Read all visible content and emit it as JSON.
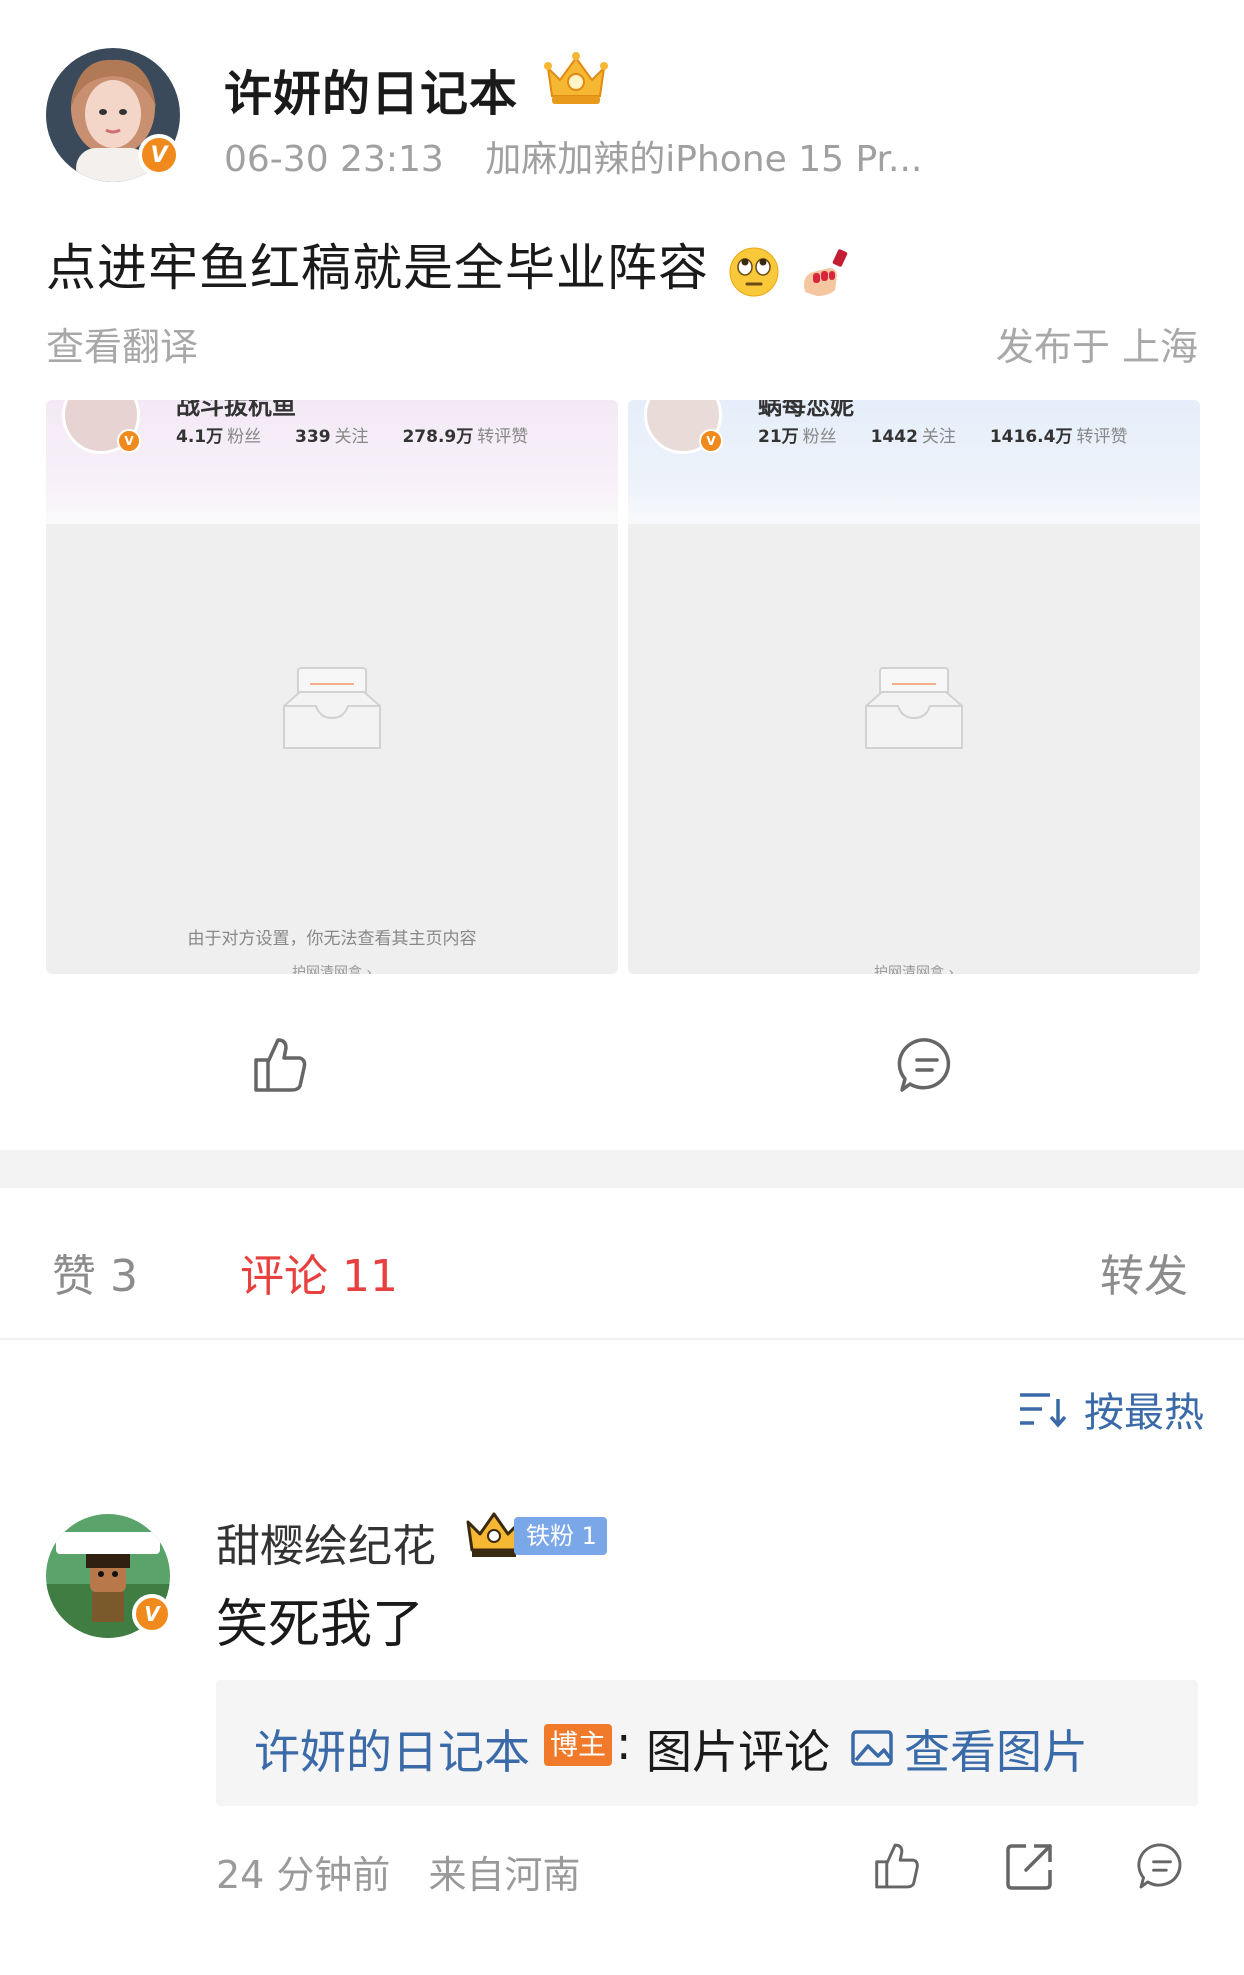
{
  "post": {
    "author": "许妍的日记本",
    "time": "06-30 23:13",
    "device": "加麻加辣的iPhone 15 Pr...",
    "text": "点进牢鱼红稿就是全毕业阵容",
    "emojis": [
      "eye-roll-emoji",
      "nail-polish-emoji"
    ],
    "translate": "查看翻译",
    "location": "发布于 上海"
  },
  "cards": [
    {
      "name": "战斗拔杭鱼",
      "fans": "4.1万",
      "fans_label": "粉丝",
      "following": "339",
      "following_label": "关注",
      "likes": "278.9万",
      "likes_label": "转评赞",
      "message": "由于对方设置，你无法查看其主页内容",
      "sub": "护网清网盒 ›"
    },
    {
      "name": "蜗每恋妮",
      "fans": "21万",
      "fans_label": "粉丝",
      "following": "1442",
      "following_label": "关注",
      "likes": "1416.4万",
      "likes_label": "转评赞",
      "message": "",
      "sub": "护网清网盒 ›"
    }
  ],
  "tabs": {
    "like": "赞 3",
    "comment": "评论 11",
    "repost": "转发"
  },
  "sort": {
    "label": "按最热"
  },
  "comment": {
    "author": "甜樱绘纪花",
    "fan_badge": "铁粉 1",
    "text": "笑死我了",
    "reply": {
      "author": "许妍的日记本",
      "tag": "博主",
      "colon": ":",
      "label": "图片评论",
      "view": "查看图片"
    },
    "time": "24 分钟前",
    "from": "来自河南"
  },
  "colors": {
    "accent_red": "#e8403e",
    "link_blue": "#3a6aa8",
    "verified_orange": "#f08a1c",
    "fan_badge_blue": "#7aa7e8"
  }
}
